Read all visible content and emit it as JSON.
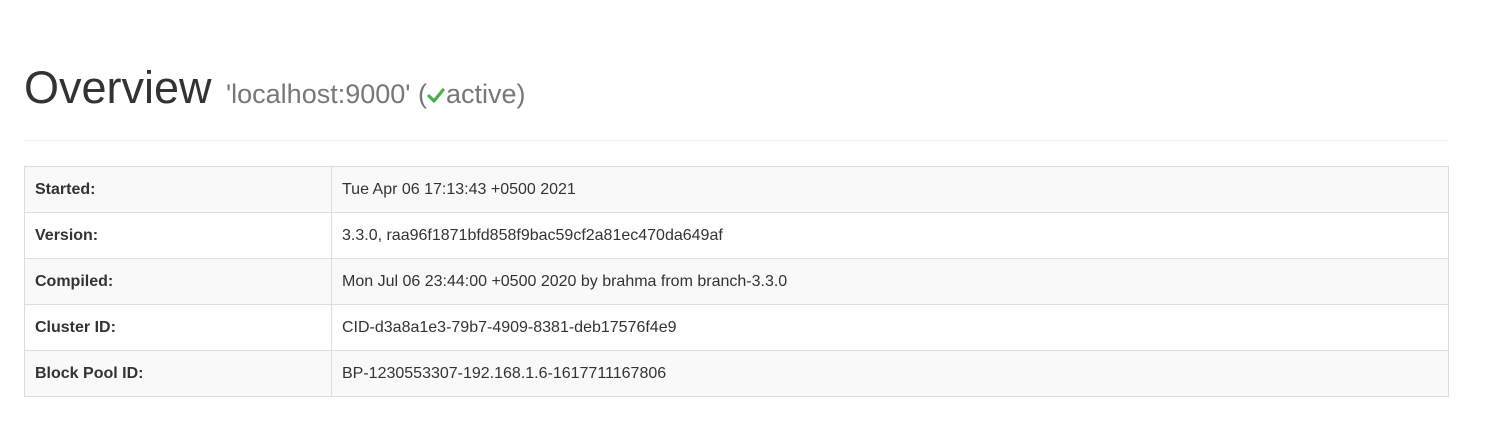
{
  "header": {
    "title": "Overview",
    "host": "'localhost:9000'",
    "status_open": "(",
    "status": "active",
    "status_close": ")",
    "status_icon": "check-icon",
    "status_color": "#4cae4c"
  },
  "info": [
    {
      "label": "Started:",
      "value": "Tue Apr 06 17:13:43 +0500 2021"
    },
    {
      "label": "Version:",
      "value": "3.3.0, raa96f1871bfd858f9bac59cf2a81ec470da649af"
    },
    {
      "label": "Compiled:",
      "value": "Mon Jul 06 23:44:00 +0500 2020 by brahma from branch-3.3.0"
    },
    {
      "label": "Cluster ID:",
      "value": "CID-d3a8a1e3-79b7-4909-8381-deb17576f4e9"
    },
    {
      "label": "Block Pool ID:",
      "value": "BP-1230553307-192.168.1.6-1617711167806"
    }
  ]
}
